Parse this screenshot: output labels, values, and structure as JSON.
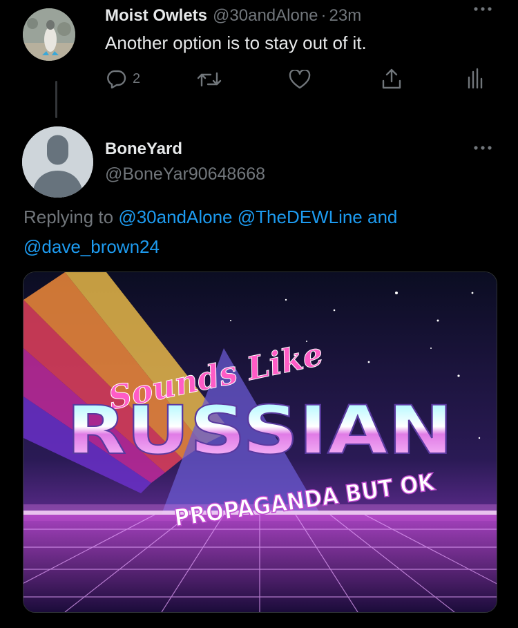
{
  "tweet1": {
    "display_name": "Moist Owlets",
    "handle": "@30andAlone",
    "separator": "·",
    "time": "23m",
    "text": "Another option is to stay out of it.",
    "reply_count": "2",
    "icons": [
      "more-icon",
      "reply-icon",
      "retweet-icon",
      "like-icon",
      "share-icon",
      "analytics-icon"
    ]
  },
  "tweet2": {
    "display_name": "BoneYard",
    "handle": "@BoneYar90648668",
    "replying_prefix": "Replying to",
    "mention1": "@30andAlone",
    "mention2": "@TheDEWLine",
    "and_word": "and",
    "mention3": "@dave_brown24",
    "media": {
      "line1": "Sounds Like",
      "line2": "RUSSIAN",
      "line3": "PROPAGANDA BUT OK"
    }
  },
  "colors": {
    "background": "#000000",
    "text": "#e7e9ea",
    "secondary": "#71767b",
    "link": "#1d9bf0"
  }
}
